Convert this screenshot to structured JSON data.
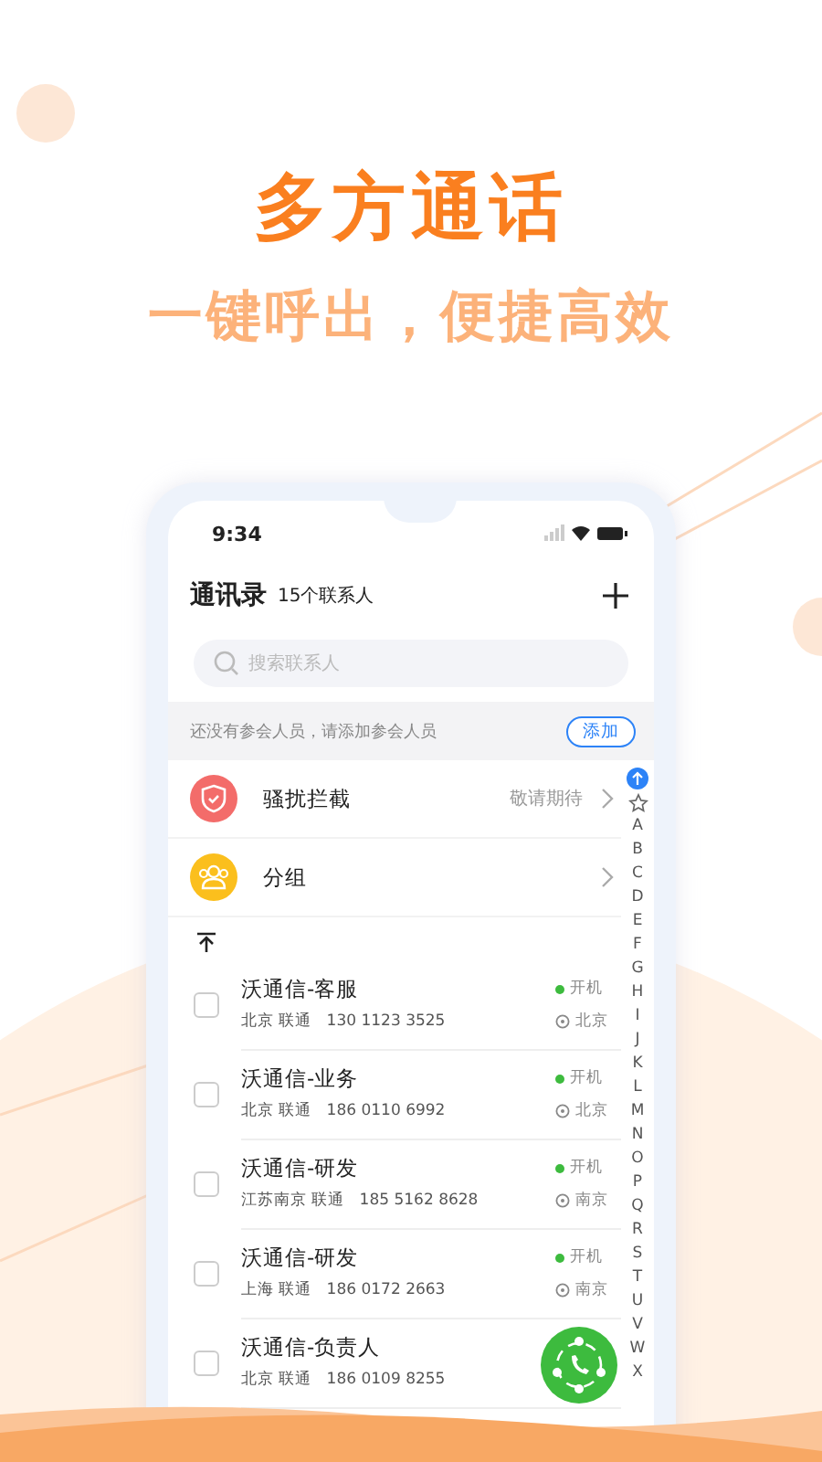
{
  "headline": "多方通话",
  "subheadline": "一键呼出，便捷高效",
  "status_bar": {
    "time": "9:34"
  },
  "header": {
    "title": "通讯录",
    "count": "15个联系人"
  },
  "search": {
    "placeholder": "搜索联系人"
  },
  "notice": {
    "text": "还没有参会人员，请添加参会人员",
    "button": "添加"
  },
  "menu": [
    {
      "kind": "block",
      "label": "骚扰拦截",
      "note": "敬请期待",
      "color": "#f36c6a"
    },
    {
      "kind": "group",
      "label": "分组",
      "color": "#fbbf1d"
    }
  ],
  "contacts": [
    {
      "name": "沃通信-客服",
      "detail": "北京 联通   130 1123 3525",
      "status": "开机",
      "location": "北京",
      "checked": false
    },
    {
      "name": "沃通信-业务",
      "detail": "北京 联通   186 0110 6992",
      "status": "开机",
      "location": "北京",
      "checked": false
    },
    {
      "name": "沃通信-研发",
      "detail": "江苏南京 联通   185 5162 8628",
      "status": "开机",
      "location": "南京",
      "checked": false
    },
    {
      "name": "沃通信-研发",
      "detail": "上海 联通   186 0172 2663",
      "status": "开机",
      "location": "南京",
      "checked": false
    },
    {
      "name": "沃通信-负责人",
      "detail": "北京 联通   186 0109 8255",
      "checked": false
    }
  ],
  "index": [
    "A",
    "B",
    "C",
    "D",
    "E",
    "F",
    "G",
    "H",
    "I",
    "J",
    "K",
    "L",
    "M",
    "N",
    "O",
    "P",
    "Q",
    "R",
    "S",
    "T",
    "U",
    "V",
    "W",
    "X"
  ]
}
